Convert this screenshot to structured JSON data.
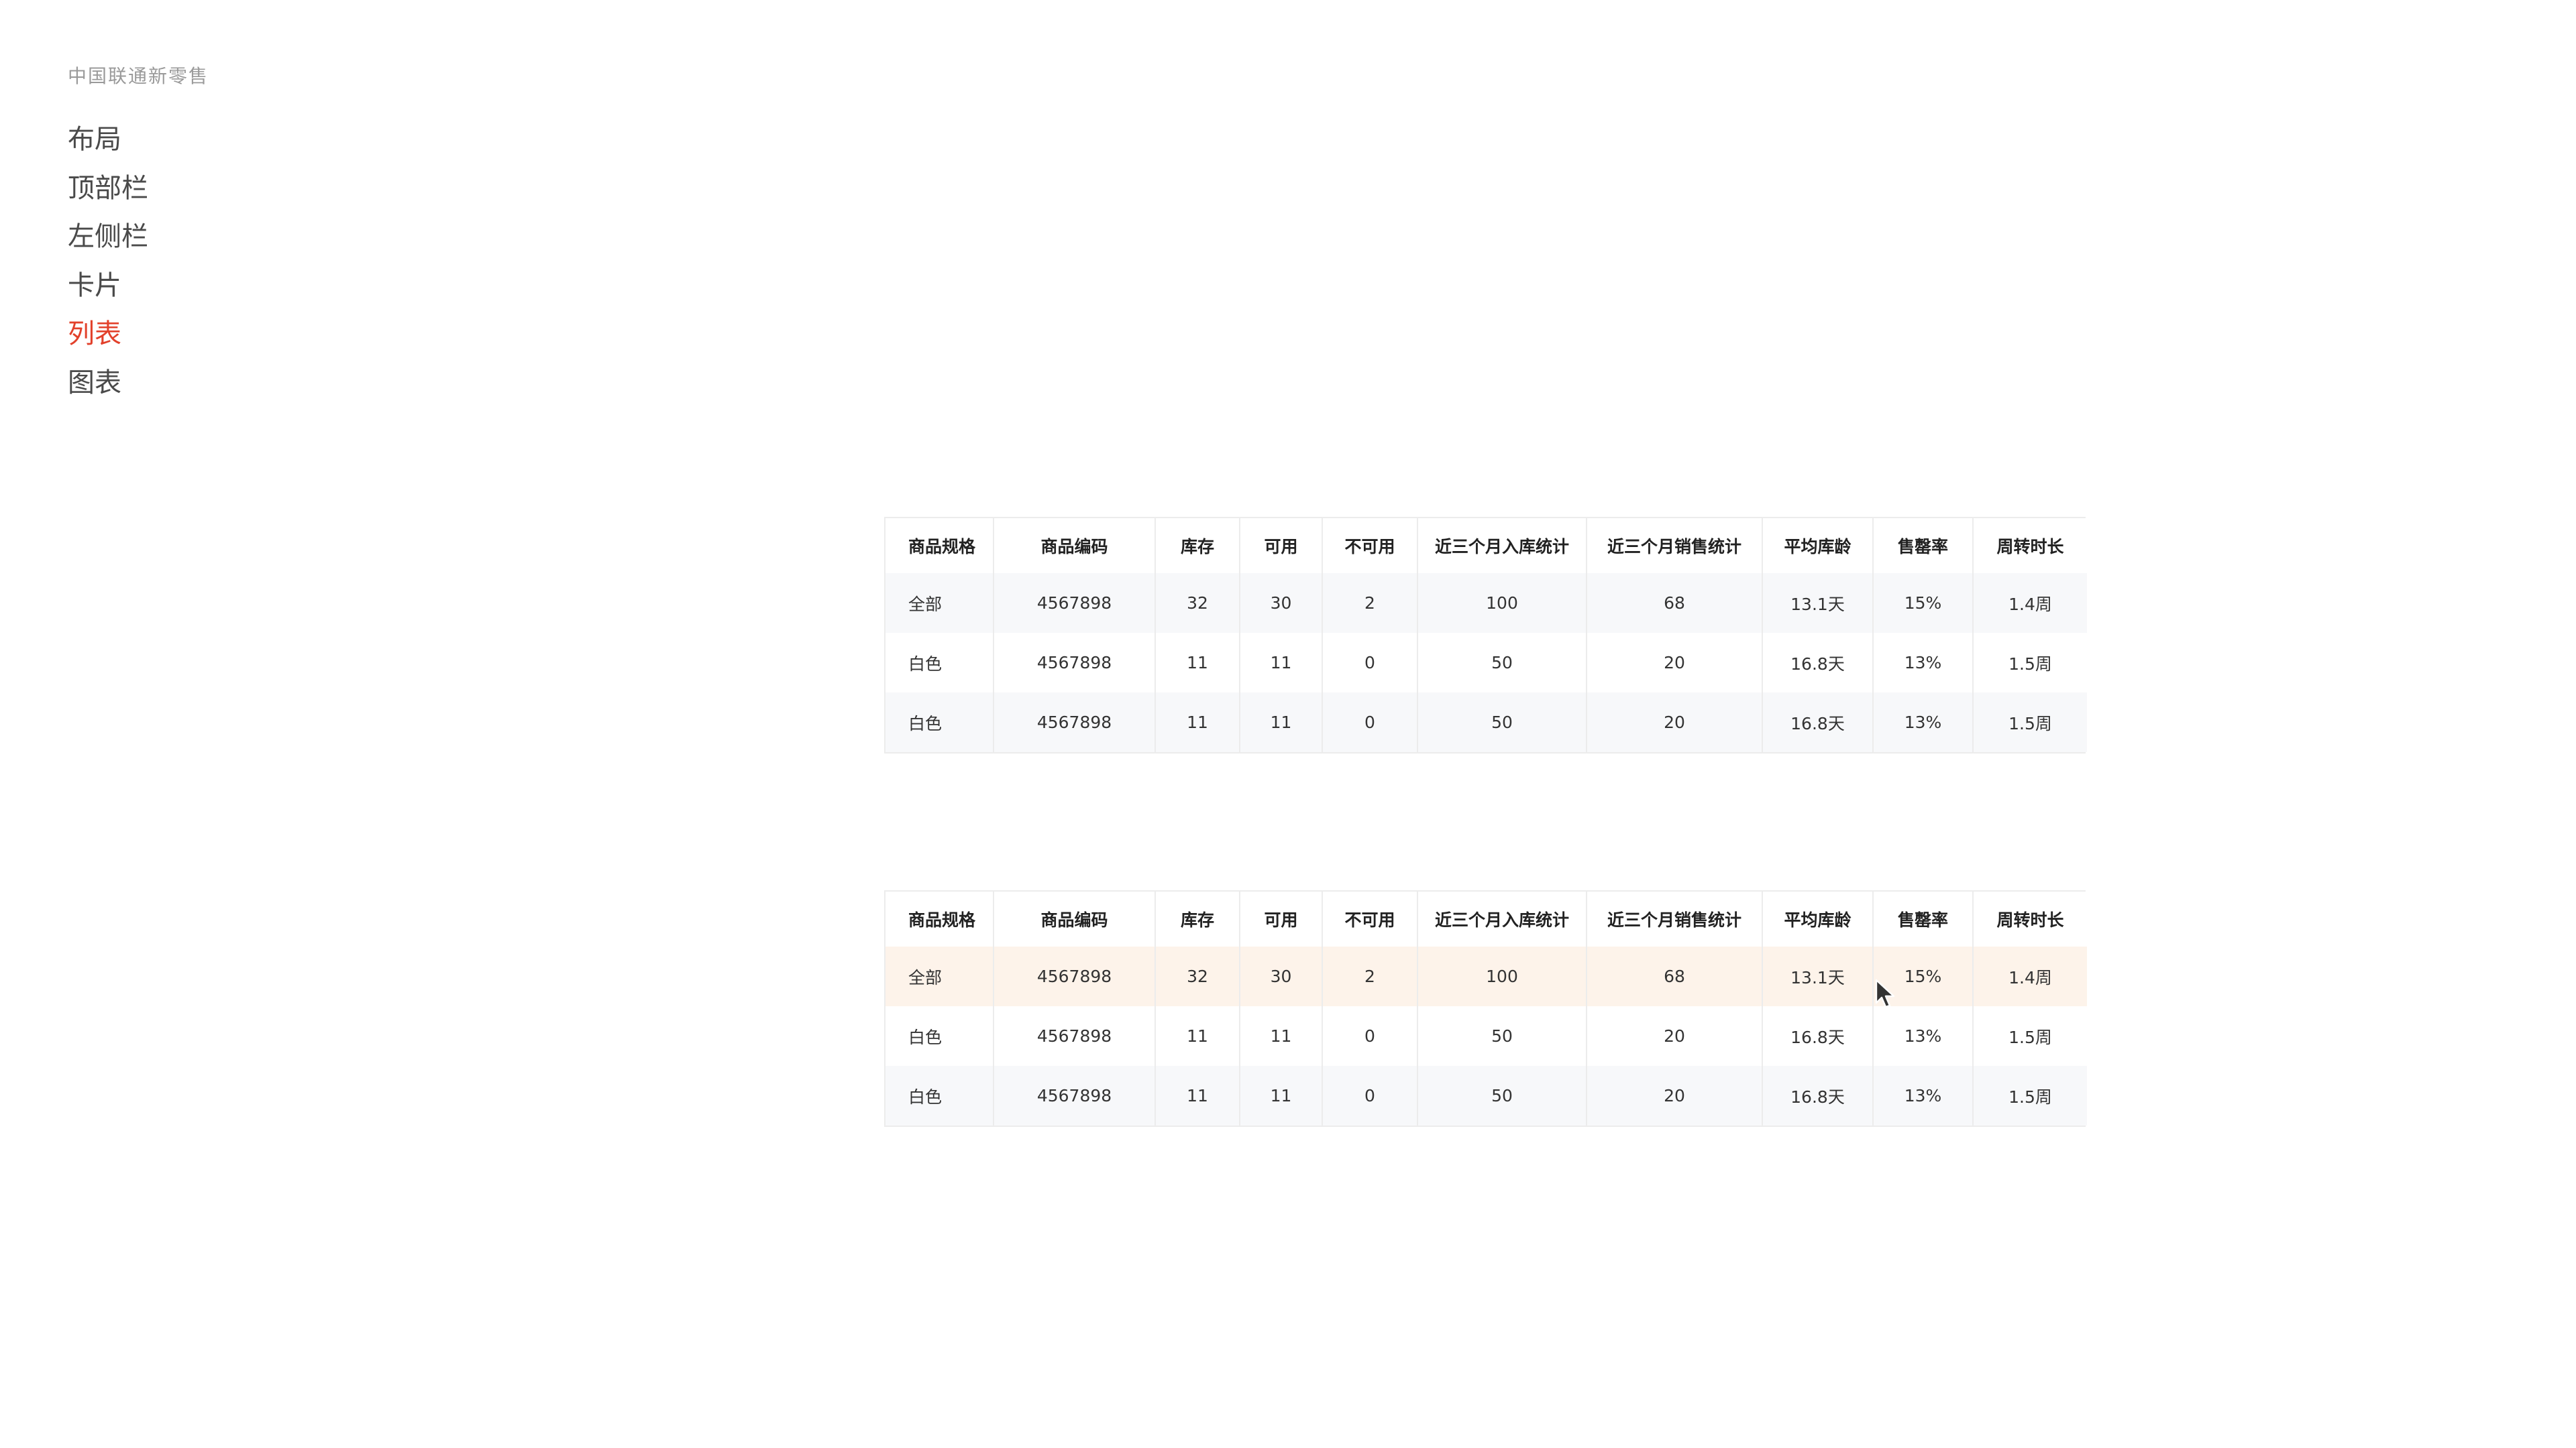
{
  "brand": "中国联通新零售",
  "nav": {
    "items": [
      {
        "label": "布局"
      },
      {
        "label": "顶部栏"
      },
      {
        "label": "左侧栏"
      },
      {
        "label": "卡片"
      },
      {
        "label": "列表",
        "active": true
      },
      {
        "label": "图表"
      }
    ]
  },
  "colors": {
    "accent": "#e2412b",
    "row_shade": "#f7f8fa",
    "row_hover": "#fdf3ea",
    "border": "#ececec"
  },
  "table1": {
    "headers": [
      "商品规格",
      "商品编码",
      "库存",
      "可用",
      "不可用",
      "近三个月入库统计",
      "近三个月销售统计",
      "平均库龄",
      "售罄率",
      "周转时长"
    ],
    "rows": [
      [
        "全部",
        "4567898",
        "32",
        "30",
        "2",
        "100",
        "68",
        "13.1天",
        "15%",
        "1.4周"
      ],
      [
        "白色",
        "4567898",
        "11",
        "11",
        "0",
        "50",
        "20",
        "16.8天",
        "13%",
        "1.5周"
      ],
      [
        "白色",
        "4567898",
        "11",
        "11",
        "0",
        "50",
        "20",
        "16.8天",
        "13%",
        "1.5周"
      ]
    ]
  },
  "table2": {
    "headers": [
      "商品规格",
      "商品编码",
      "库存",
      "可用",
      "不可用",
      "近三个月入库统计",
      "近三个月销售统计",
      "平均库龄",
      "售罄率",
      "周转时长"
    ],
    "rows": [
      [
        "全部",
        "4567898",
        "32",
        "30",
        "2",
        "100",
        "68",
        "13.1天",
        "15%",
        "1.4周"
      ],
      [
        "白色",
        "4567898",
        "11",
        "11",
        "0",
        "50",
        "20",
        "16.8天",
        "13%",
        "1.5周"
      ],
      [
        "白色",
        "4567898",
        "11",
        "11",
        "0",
        "50",
        "20",
        "16.8天",
        "13%",
        "1.5周"
      ]
    ],
    "hovered_row": 0
  },
  "cursor_icon": "mouse-pointer-icon"
}
